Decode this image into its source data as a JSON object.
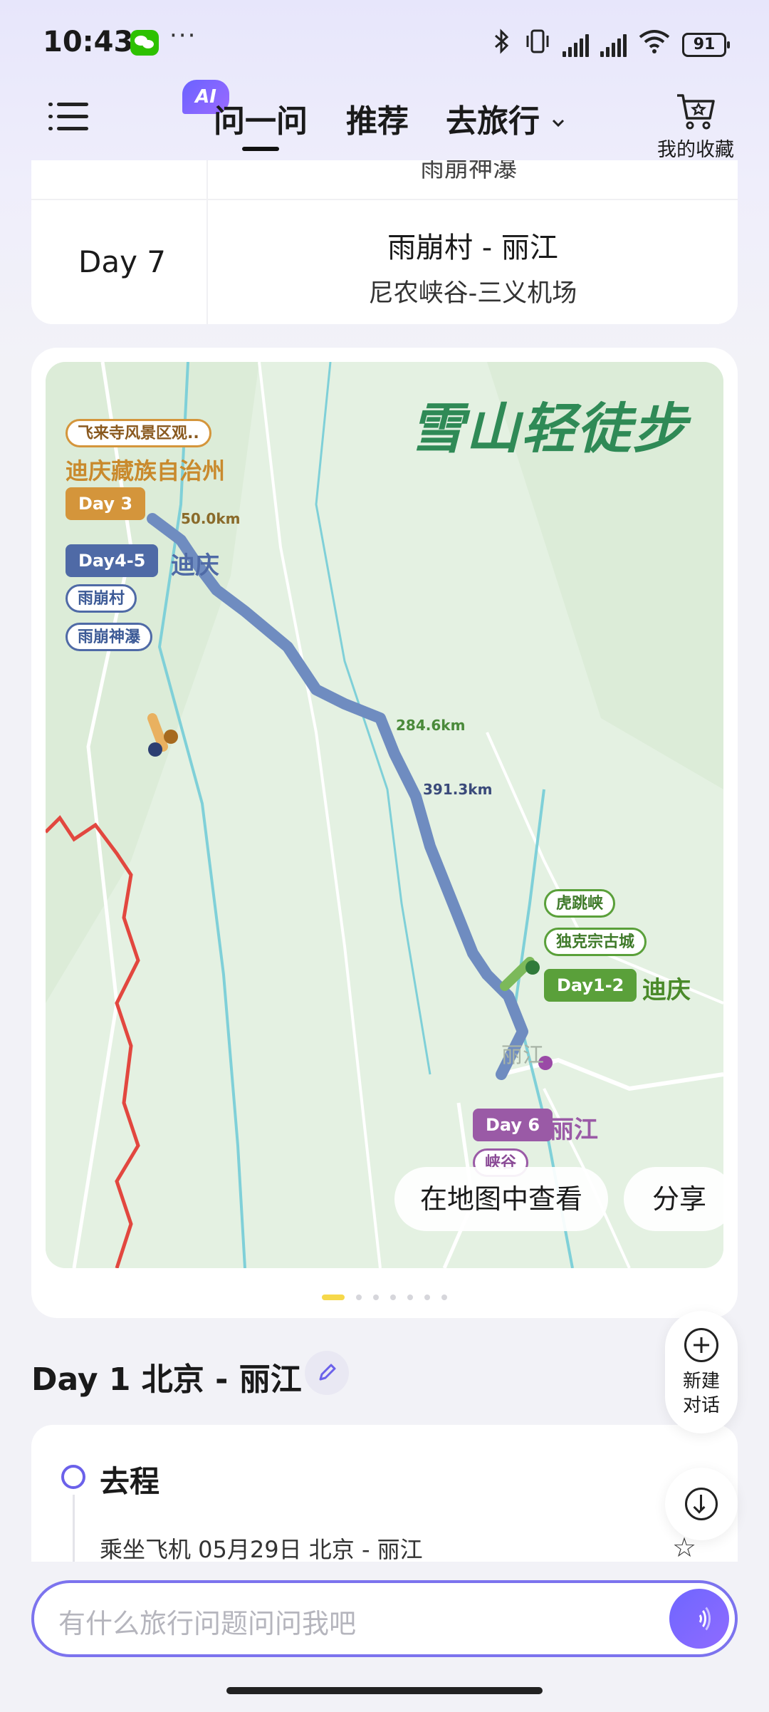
{
  "status_bar": {
    "time": "10:43",
    "more": "···",
    "battery": "91",
    "icons": [
      "wechat-icon",
      "bluetooth-icon",
      "vibrate-icon",
      "signal-icon",
      "signal-icon",
      "wifi-icon",
      "battery-icon"
    ]
  },
  "header": {
    "ai_badge": "AI",
    "tabs": [
      {
        "label": "问一问",
        "active": true
      },
      {
        "label": "推荐",
        "active": false
      },
      {
        "label": "去旅行",
        "active": false
      }
    ],
    "favorites_label": "我的收藏"
  },
  "table": {
    "prev_row_partial": "雨崩神瀑",
    "day_label": "Day 7",
    "route": "雨崩村 - 丽江",
    "sub_route": "尼农峡谷-三义机场"
  },
  "map": {
    "title": "雪山轻徒步",
    "labels": {
      "feilaisi": "飞来寺风景区观..",
      "diqing_prefecture": "迪庆藏族自治州",
      "day3": "Day 3",
      "day45": "Day4-5",
      "diqing_a": "迪庆",
      "yubeng_village": "雨崩村",
      "yubeng_waterfall": "雨崩神瀑",
      "dist_50": "50.0km",
      "dist_284": "284.6km",
      "dist_391": "391.3km",
      "tiger_leaping": "虎跳峡",
      "dukezong": "独克宗古城",
      "day12": "Day1-2",
      "diqing_b": "迪庆",
      "lijiang_map": "丽江",
      "day6": "Day 6",
      "lijiang": "丽江",
      "canyon": "峡谷"
    },
    "colors": {
      "green_title": "#2f8a56",
      "day3": "#d4953b",
      "day45": "#4f6aa6",
      "day12": "#5aa03a",
      "day6": "#9a5aa6",
      "route": "#6f8cc0",
      "border": "#e2473f"
    },
    "view_button": "在地图中查看",
    "share_button": "分享",
    "pager": {
      "count": 7,
      "active": 1
    }
  },
  "day1": {
    "heading": "Day 1 北京 - 丽江"
  },
  "fab": {
    "new_chat_label": "新建对话"
  },
  "itinerary": {
    "title": "去程",
    "desc": "乘坐飞机 05月29日 北京 - 丽江"
  },
  "input": {
    "placeholder": "有什么旅行问题问问我吧"
  }
}
